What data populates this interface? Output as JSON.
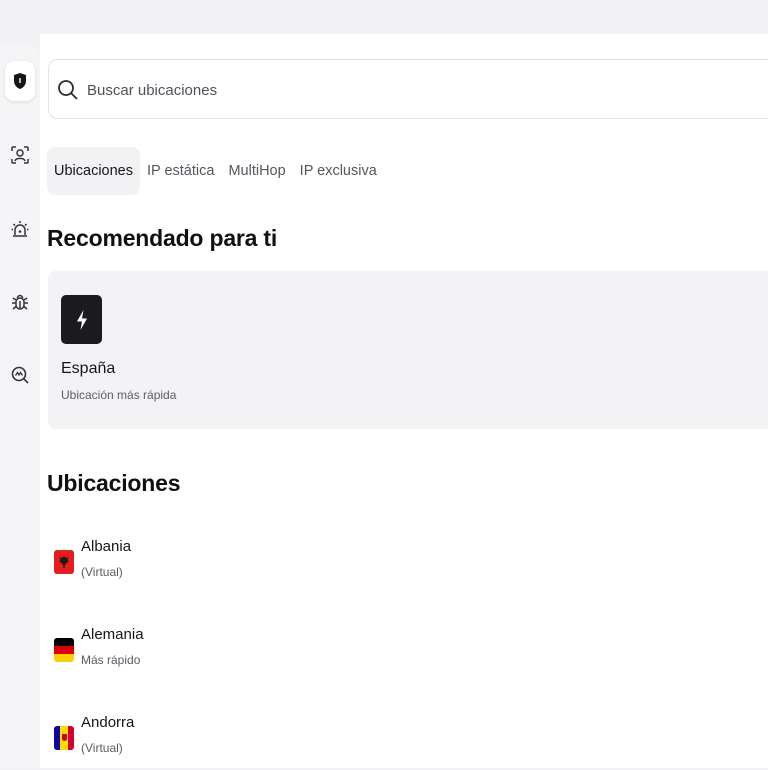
{
  "sidebar": {
    "items": [
      {
        "name": "vpn",
        "icon": "shield-icon",
        "active": true
      },
      {
        "name": "identity",
        "icon": "user-scan-icon",
        "active": false
      },
      {
        "name": "alerts",
        "icon": "alarm-icon",
        "active": false
      },
      {
        "name": "threats",
        "icon": "bug-icon",
        "active": false
      },
      {
        "name": "scan",
        "icon": "magnifier-scan-icon",
        "active": false
      }
    ]
  },
  "search": {
    "placeholder": "Buscar ubicaciones",
    "value": ""
  },
  "tabs": [
    {
      "label": "Ubicaciones",
      "active": true
    },
    {
      "label": "IP estática",
      "active": false
    },
    {
      "label": "MultiHop",
      "active": false
    },
    {
      "label": "IP exclusiva",
      "active": false
    }
  ],
  "recommended": {
    "heading": "Recomendado para ti",
    "card": {
      "icon": "lightning-icon",
      "title": "España",
      "subtitle": "Ubicación más rápida"
    }
  },
  "locations": {
    "heading": "Ubicaciones",
    "items": [
      {
        "name": "Albania",
        "subtitle": "(Virtual)",
        "flag": "albania-flag"
      },
      {
        "name": "Alemania",
        "subtitle": "Más rápido",
        "flag": "germany-flag"
      },
      {
        "name": "Andorra",
        "subtitle": "(Virtual)",
        "flag": "andorra-flag"
      }
    ]
  },
  "colors": {
    "accent_dark": "#1b1b1f",
    "card_bg": "#f3f3f5",
    "albania_red": "#e41e20",
    "germany_black": "#000000",
    "germany_red": "#dd0000",
    "germany_gold": "#ffce00",
    "andorra_blue": "#10069f",
    "andorra_yellow": "#fedd00",
    "andorra_red": "#d50032"
  }
}
